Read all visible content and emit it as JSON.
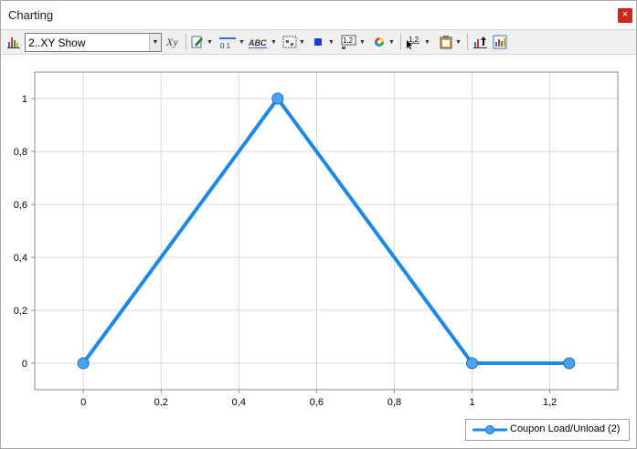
{
  "window": {
    "title": "Charting",
    "close_glyph": "×"
  },
  "toolbar": {
    "series_select": {
      "value": "2..XY Show"
    },
    "tools": [
      {
        "icon": "bar-chart-icon"
      },
      {
        "icon": "axis-xy-icon"
      },
      {
        "icon": "edit-pen-icon"
      },
      {
        "icon": "axis-scale-icon",
        "text": "0  1"
      },
      {
        "icon": "text-label-icon",
        "text": "ABC"
      },
      {
        "icon": "marker-style-icon"
      },
      {
        "icon": "marker-color-icon"
      },
      {
        "icon": "data-label-icon",
        "text": "1,2"
      },
      {
        "icon": "color-palette-icon"
      },
      {
        "icon": "cursor-value-icon",
        "text": "1,2"
      },
      {
        "icon": "clipboard-icon"
      },
      {
        "icon": "export-chart-icon"
      },
      {
        "icon": "chart-properties-icon"
      }
    ]
  },
  "colors": {
    "series": "#1e88e5",
    "marker": "#4aa3ef",
    "grid": "#d9d9d9",
    "close": "#c42b1c"
  },
  "chart_data": {
    "type": "line",
    "x": [
      0,
      0.5,
      1,
      1.25
    ],
    "series": [
      {
        "name": "Coupon Load/Unload (2)",
        "values": [
          0,
          1,
          0,
          0
        ]
      }
    ],
    "xlim": [
      -0.125,
      1.375
    ],
    "ylim": [
      -0.1,
      1.1
    ],
    "x_ticks": [
      0,
      0.2,
      0.4,
      0.6,
      0.8,
      1,
      1.2
    ],
    "y_ticks": [
      0,
      0.2,
      0.4,
      0.6,
      0.8,
      1
    ],
    "x_tick_labels": [
      "0",
      "0,2",
      "0,4",
      "0,6",
      "0,8",
      "1",
      "1,2"
    ],
    "y_tick_labels": [
      "0",
      "0,2",
      "0,4",
      "0,6",
      "0,8",
      "1"
    ],
    "grid": true,
    "legend": "bottom-right"
  }
}
